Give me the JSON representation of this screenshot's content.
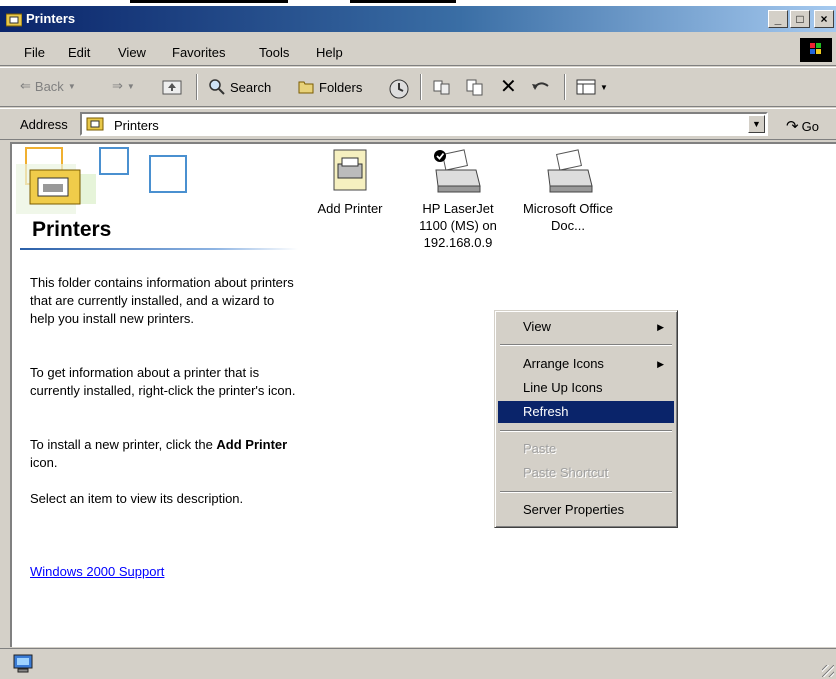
{
  "window": {
    "title": "Printers"
  },
  "menubar": {
    "items": [
      "File",
      "Edit",
      "View",
      "Favorites",
      "Tools",
      "Help"
    ]
  },
  "toolbar": {
    "back_label": "Back",
    "search_label": "Search",
    "folders_label": "Folders"
  },
  "address": {
    "label": "Address",
    "value": "Printers",
    "go_label": "Go"
  },
  "panel": {
    "title": "Printers",
    "p1": "This folder contains information about printers that are currently installed, and a wizard to help you install new printers.",
    "p2": "To get information about a printer that is currently installed, right-click the printer's icon.",
    "p3_prefix": "To install a new printer, click the ",
    "p3_bold": "Add Printer",
    "p3_suffix": " icon.",
    "p4": "Select an item to view its description.",
    "support_link": "Windows 2000 Support"
  },
  "printers": [
    {
      "label": "Add Printer"
    },
    {
      "label": "HP LaserJet 1100 (MS) on 192.168.0.9"
    },
    {
      "label": "Microsoft Office Doc..."
    }
  ],
  "context_menu": {
    "view": "View",
    "arrange_icons": "Arrange Icons",
    "line_up_icons": "Line Up Icons",
    "refresh": "Refresh",
    "paste": "Paste",
    "paste_shortcut": "Paste Shortcut",
    "server_properties": "Server Properties"
  },
  "colors": {
    "titlebar": "#0a246a",
    "selection": "#0a246a",
    "link": "#0000ff"
  }
}
